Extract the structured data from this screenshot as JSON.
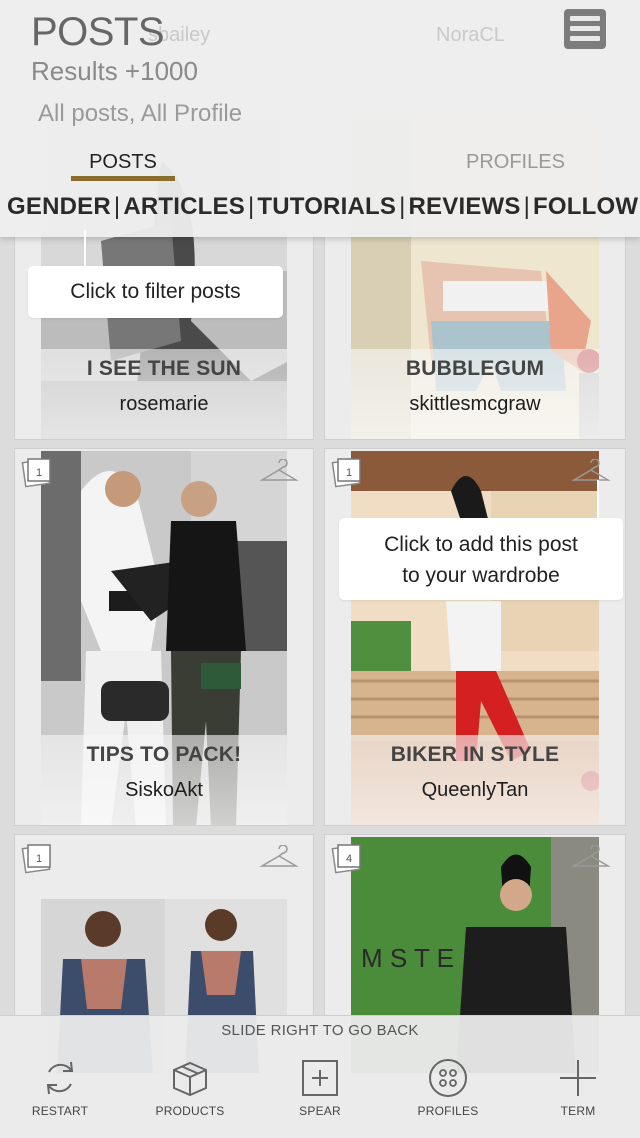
{
  "header": {
    "title": "POSTS",
    "results": "Results +1000",
    "filters": "All posts,   All Profile",
    "ghost_left": "sbailey",
    "ghost_right": "NoraCL",
    "menu_icon": "hamburger-menu-icon",
    "tabs": {
      "posts": "POSTS",
      "profiles": "PROFILES"
    },
    "accent_color": "#8a6d2c",
    "categories": [
      "GENDER",
      "ARTICLES",
      "TUTORIALS",
      "REVIEWS",
      "FOLLOW"
    ]
  },
  "tooltips": {
    "filter": "Click to filter posts",
    "wardrobe_line1": "Click to add this post",
    "wardrobe_line2": "to your wardrobe"
  },
  "posts": [
    {
      "title": "I SEE THE SUN",
      "user": "rosemarie"
    },
    {
      "title": "BUBBLEGUM",
      "user": "skittlesmcgraw"
    },
    {
      "title": "TIPS TO PACK!",
      "user": "SiskoAkt",
      "count": "1"
    },
    {
      "title": "BIKER IN STYLE",
      "user": "QueenlyTan",
      "count": "1"
    },
    {
      "title": "",
      "user": "",
      "count": "1"
    },
    {
      "title": "",
      "user": "",
      "count": "4"
    }
  ],
  "bottom": {
    "hint": "SLIDE RIGHT TO GO BACK",
    "nav": [
      {
        "label": "RESTART",
        "icon": "restart-icon"
      },
      {
        "label": "PRODUCTS",
        "icon": "box-icon"
      },
      {
        "label": "SPEAR",
        "icon": "plus-square-icon"
      },
      {
        "label": "PROFILES",
        "icon": "profiles-icon"
      },
      {
        "label": "TERM",
        "icon": "plus-icon"
      }
    ]
  }
}
